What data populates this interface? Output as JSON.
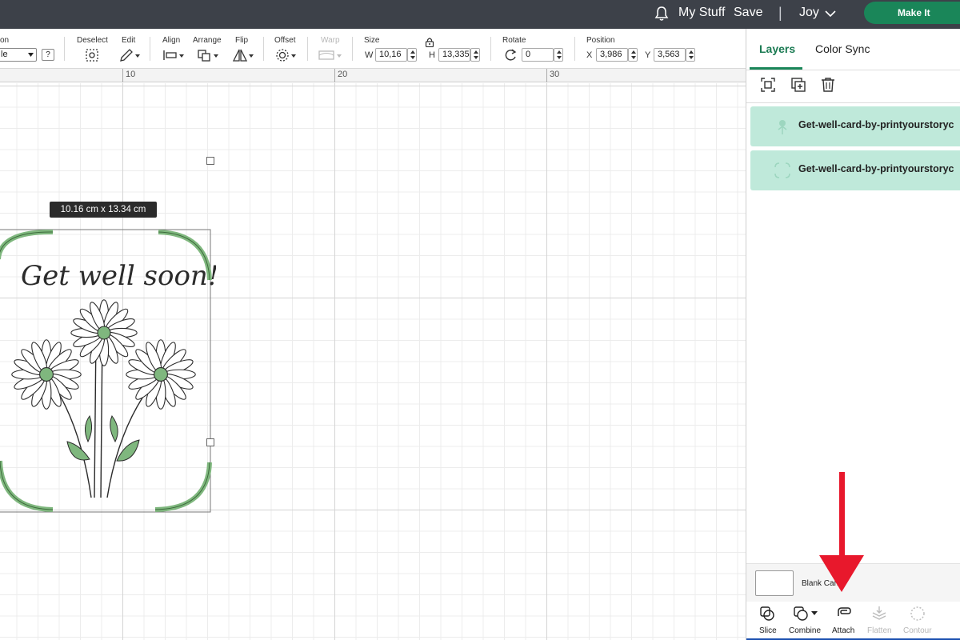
{
  "topbar": {
    "my_stuff": "My Stuff",
    "save": "Save",
    "separator": "|",
    "user": "Joy",
    "make_it": "Make It",
    "accent_color": "#1a8659"
  },
  "toolbar": {
    "operation_label": "on",
    "operation_value": "le",
    "help": "?",
    "deselect": "Deselect",
    "edit": "Edit",
    "align": "Align",
    "arrange": "Arrange",
    "flip": "Flip",
    "offset": "Offset",
    "warp": "Warp",
    "size": "Size",
    "w_label": "W",
    "w_value": "10,16",
    "h_label": "H",
    "h_value": "13,335",
    "rotate": "Rotate",
    "rotate_value": "0",
    "position": "Position",
    "x_label": "X",
    "x_value": "3,986",
    "y_label": "Y",
    "y_value": "3,563"
  },
  "ruler": {
    "marks": [
      "10",
      "20",
      "30"
    ]
  },
  "canvas": {
    "tooltip": "10.16  cm x 13.34  cm",
    "card_text": "Get well soon!"
  },
  "panel": {
    "tabs": [
      "Layers",
      "Color Sync"
    ],
    "layers": [
      {
        "name": "Get-well-card-by-printyourstoryc"
      },
      {
        "name": "Get-well-card-by-printyourstoryc"
      }
    ],
    "blank_canvas": "Blank Can",
    "tools": [
      {
        "label": "Slice",
        "icon": "slice-icon"
      },
      {
        "label": "Combine",
        "icon": "combine-icon"
      },
      {
        "label": "Attach",
        "icon": "attach-icon"
      },
      {
        "label": "Flatten",
        "icon": "flatten-icon"
      },
      {
        "label": "Contour",
        "icon": "contour-icon"
      }
    ],
    "layer_color": "#bfe9da"
  },
  "annotation": {
    "arrow_color": "#e8182c"
  }
}
